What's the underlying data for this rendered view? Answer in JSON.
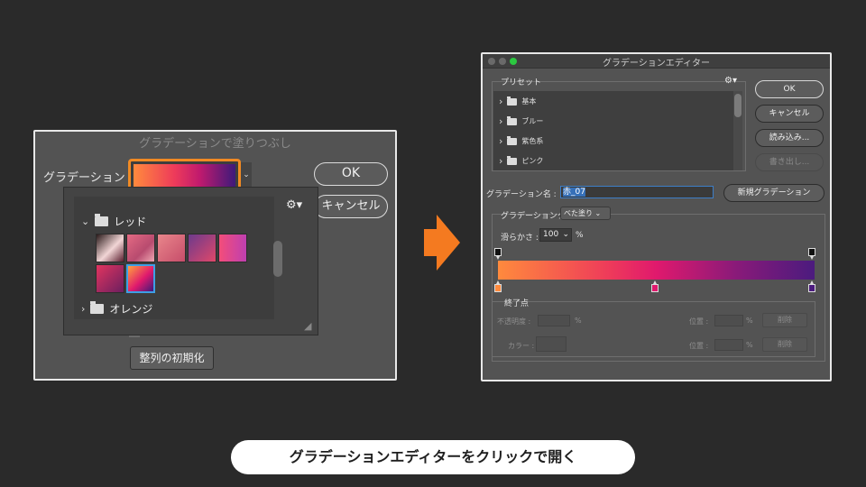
{
  "left_dialog": {
    "title": "グラデーションで塗りつぶし",
    "gradient_label": "グラデーション :",
    "ok": "OK",
    "cancel": "キャンセル",
    "reset": "整列の初期化"
  },
  "preset_popover": {
    "folder_open": "レッド",
    "folder_closed": "オレンジ",
    "swatch_gradients": [
      "linear-gradient(135deg,#2a1a1a,#f2d6d6 55%,#5a1d2e)",
      "linear-gradient(135deg,#e46a83,#b84b6f 60%,#f0a8b3)",
      "linear-gradient(135deg,#e9868b,#c64d6a)",
      "linear-gradient(135deg,#6c3a8c,#e0486a)",
      "linear-gradient(90deg,#f34d7a,#bf3fb0)",
      "linear-gradient(135deg,#e2345f,#6b1f5f)",
      "linear-gradient(135deg,#ffa23d,#e0196d 55%,#3d1a7a)"
    ]
  },
  "editor": {
    "title": "グラデーションエディター",
    "presets_label": "プリセット",
    "preset_folders": [
      "基本",
      "ブルー",
      "紫色系",
      "ピンク"
    ],
    "ok": "OK",
    "cancel": "キャンセル",
    "load": "読み込み...",
    "save": "書き出し...",
    "name_label": "グラデーション名 :",
    "name_value": "赤_07",
    "new_gradient": "新規グラデーション",
    "type_label": "グラデーションタイプ :",
    "type_value": "べた塗り",
    "smoothness_label": "滑らかさ :",
    "smoothness_value": "100",
    "percent": "%",
    "stops_title": "終了点",
    "opacity_label": "不透明度 :",
    "location_label": "位置 :",
    "color_label": "カラー :",
    "delete": "削除",
    "stop_colors": [
      "#ff8a3d",
      "#e0196d",
      "#4b1b7e"
    ]
  },
  "caption": "グラデーションエディターをクリックで開く",
  "colors": {
    "accent_orange": "#f08a24",
    "arrow": "#f47a20",
    "selection_blue": "#3d9fe6"
  }
}
